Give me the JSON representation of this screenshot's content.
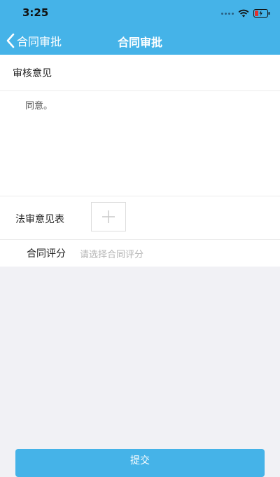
{
  "status_bar": {
    "time": "3:25"
  },
  "nav": {
    "back_label": "合同审批",
    "title": "合同审批"
  },
  "review": {
    "section_title": "审核意见",
    "opinion_value": "同意。"
  },
  "legal": {
    "label": "法审意见表"
  },
  "score": {
    "label": "合同评分",
    "placeholder": "请选择合同评分"
  },
  "submit": {
    "label": "提交"
  },
  "colors": {
    "header_bg": "#45b3e8",
    "page_bg": "#f1f1f5"
  }
}
